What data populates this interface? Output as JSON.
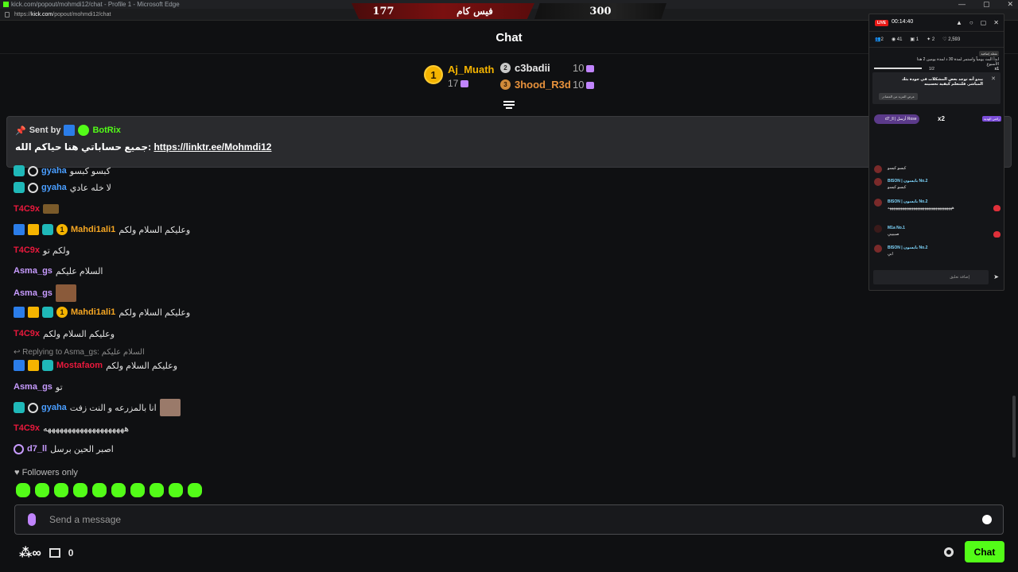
{
  "browser": {
    "window_title": "kick.com/popout/mohmdi12/chat - Profile 1 - Microsoft Edge",
    "url_scheme": "https://",
    "url_host": "kick.com",
    "url_path": "/popout/mohmdi12/chat",
    "controls": [
      "—",
      "▢",
      "✕"
    ]
  },
  "scoreboard": {
    "left_score": "177",
    "left_title": "فيس كام",
    "right_score": "300"
  },
  "chat": {
    "title": "Chat",
    "leaderboard": {
      "first": {
        "rank": "1",
        "name": "Aj_Muath",
        "count": "17"
      },
      "second": {
        "rank": "2",
        "name": "c3badii",
        "count": "10"
      },
      "third": {
        "rank": "3",
        "name": "3hood_R3d",
        "count": "10"
      }
    },
    "pinned": {
      "sent_by": "Sent by",
      "sender": "BotRix",
      "text": "جميع حساباتي هنا حياكم الله:",
      "link": "https://linktr.ee/Mohmdi12"
    },
    "messages": [
      {
        "user": "gyaha",
        "text": "كبسو كبسو",
        "color": "#4a9eff"
      },
      {
        "user": "gyaha",
        "text": "لا خله عادي",
        "color": "#4a9eff"
      },
      {
        "user": "T4C9x",
        "text": "",
        "color": "#e8193c"
      },
      {
        "user": "Mahdi1ali1",
        "text": "وعليكم السلام ولكم",
        "color": "#f5a623"
      },
      {
        "user": "T4C9x",
        "text": "ولكم تو",
        "color": "#e8193c"
      },
      {
        "user": "Asma_gs",
        "text": "السلام عليكم",
        "color": "#c79bff"
      },
      {
        "user": "Asma_gs",
        "text": "",
        "color": "#c79bff"
      },
      {
        "user": "Mahdi1ali1",
        "text": "وعليكم السلام ولكم",
        "color": "#f5a623"
      },
      {
        "user": "T4C9x",
        "text": "وعليكم السلام ولكم",
        "color": "#e8193c"
      },
      {
        "user": "Mostafaom",
        "text": "وعليكم السلام ولكم",
        "color": "#e8193c"
      },
      {
        "user": "Asma_gs",
        "text": "تو",
        "color": "#c79bff"
      },
      {
        "user": "gyaha",
        "text": "انا بالمزرعه و النت زفت",
        "color": "#4a9eff"
      },
      {
        "user": "T4C9x",
        "text": "ههههههههههههههههههههه",
        "color": "#e8193c"
      },
      {
        "user": "d7_ll",
        "text": "اصبر الحين برسل",
        "color": "#c79bff"
      }
    ],
    "reply": {
      "prefix": "Replying to Asma_gs:",
      "quote": "السلام عليكم"
    },
    "followers_only": "Followers only",
    "input_placeholder": "Send a message",
    "points": "0",
    "chat_button": "Chat"
  },
  "overlay": {
    "live": "LIVE",
    "timer": "00:14:40",
    "stats": [
      "2",
      "41",
      "1",
      "2",
      "2,593"
    ],
    "goal_tag": "نقطة إضافية",
    "goal_text": "ابدأ البث يومياً واستمر لمدة 30 د لمدة يومين 2 هذا الأسبوع",
    "goal_progress": "1/2",
    "goal_multiplier": "x1",
    "notice_text": "يبدو أنه توجد بعض المشكلات في جودة بثك المباشر. فلتتعلم كيفية تحسينه",
    "notice_button": "عرض المزيد من المصادر",
    "gifted_pill": "d7_ll | أرسل Rose",
    "gifted_count": "x2",
    "gifted_label": "رائعي الهدية",
    "messages": [
      {
        "name": "",
        "text": "كبسو كبسو"
      },
      {
        "name": "BISON | بايسون  No.2",
        "text": "كبسو كبسو"
      },
      {
        "name": "BISON | بايسون  No.2",
        "text": "هههههههههههههههههههههههههههههههههههه"
      },
      {
        "name": "M1a  No.1",
        "text": "صبيييي"
      },
      {
        "name": "BISON | بايسون  No.2",
        "text": "ابي"
      }
    ],
    "input_placeholder": "إضافة تعليق"
  }
}
